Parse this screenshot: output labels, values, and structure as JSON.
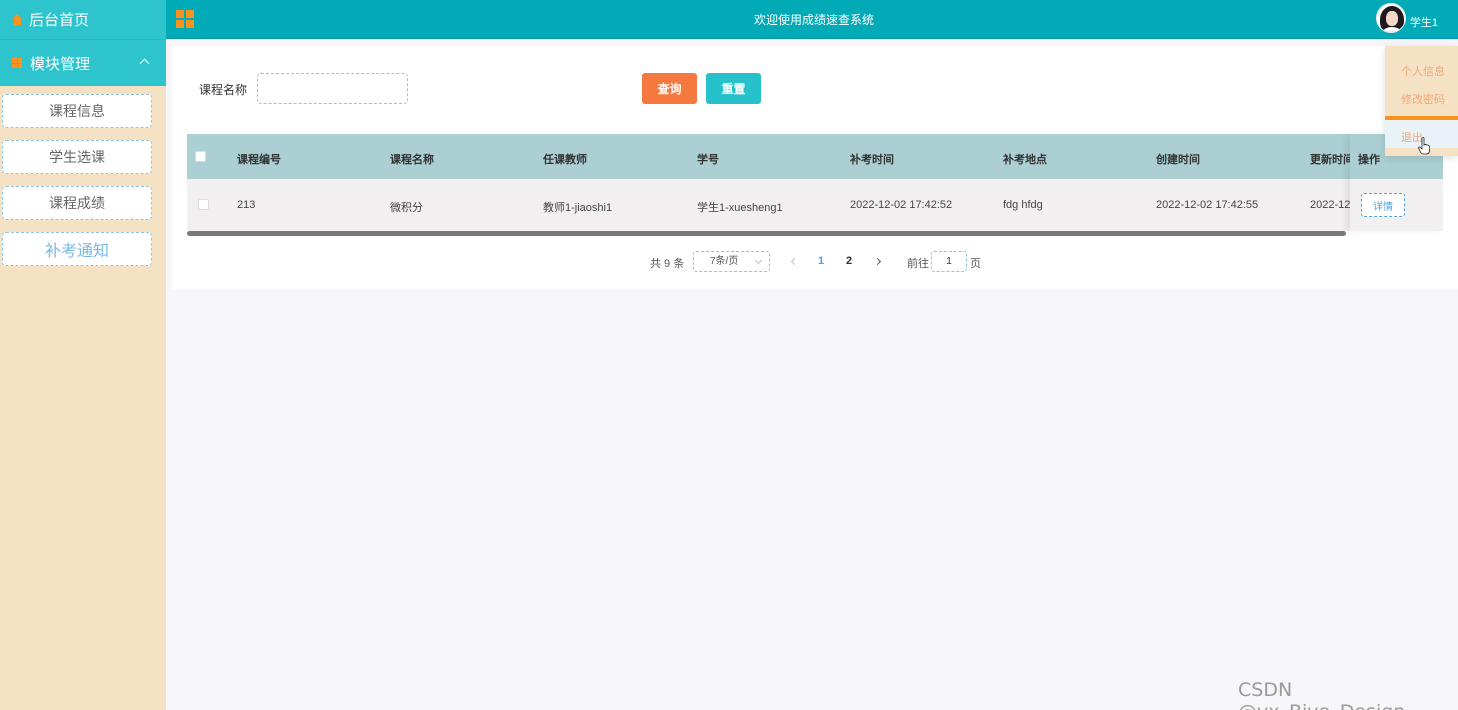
{
  "sidebar": {
    "home_label": "后台首页",
    "module_label": "模块管理",
    "items": [
      {
        "label": "课程信息"
      },
      {
        "label": "学生选课"
      },
      {
        "label": "课程成绩"
      },
      {
        "label": "补考通知"
      }
    ]
  },
  "header": {
    "title": "欢迎使用成绩速查系统",
    "username": "学生1"
  },
  "user_menu": {
    "items": [
      {
        "label": "个人信息"
      },
      {
        "label": "修改密码"
      },
      {
        "label": "退出"
      }
    ]
  },
  "search": {
    "label": "课程名称",
    "value": "",
    "query_label": "查询",
    "reset_label": "重置"
  },
  "table": {
    "columns": [
      "课程编号",
      "课程名称",
      "任课教师",
      "学号",
      "补考时间",
      "补考地点",
      "创建时间",
      "更新时间",
      "操作"
    ],
    "rows": [
      {
        "cells": [
          "213",
          "微积分",
          "教师1-jiaoshi1",
          "学生1-xuesheng1",
          "2022-12-02 17:42:52",
          "fdg hfdg",
          "2022-12-02 17:42:55",
          "2022-12"
        ],
        "action": "详情"
      }
    ]
  },
  "pagination": {
    "total": "共 9 条",
    "page_size": "7条/页",
    "pages": [
      "1",
      "2"
    ],
    "current_page": "1",
    "goto_prefix": "前往",
    "goto_value": "1",
    "goto_suffix": "页"
  },
  "watermark": "CSDN @vx_Biye_Design",
  "colors": {
    "header_bg": "#01aab7",
    "sidebar_header_bg": "#2ec4cd",
    "sidebar_bg": "#f5e2c4",
    "query_button": "#f5793e",
    "reset_button": "#27c1cc",
    "table_header": "#abcfd2",
    "accent_icon": "#f7931e",
    "active_page": "#4aa3df"
  }
}
